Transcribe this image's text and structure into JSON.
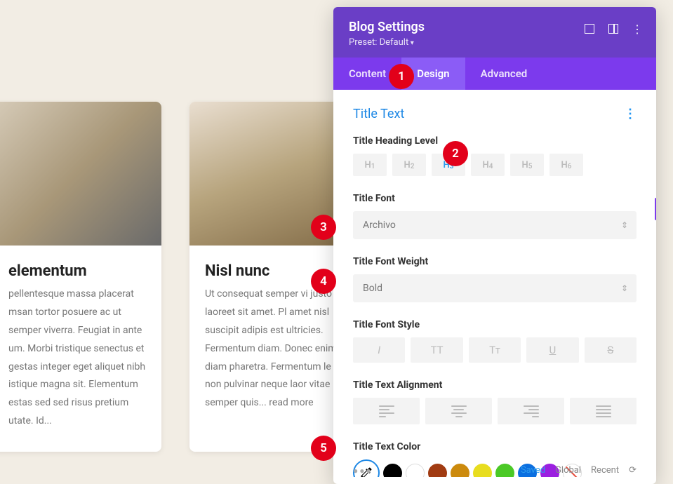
{
  "cards": [
    {
      "title": "elementum",
      "text": "pellentesque massa placerat msan tortor posuere ac ut  semper viverra. Feugiat in ante um. Morbi tristique senectus et gestas integer eget aliquet nibh istique magna sit. Elementum estas sed sed risus pretium utate. Id..."
    },
    {
      "title": "Nisl nunc",
      "text": "Ut consequat semper vi justo laoreet sit amet. Pl amet nisl suscipit adipis est ultricies. Fermentum diam. Donec enim diam pharetra. Fermentum le non pulvinar neque laor vitae semper quis... ",
      "readmore": "read more"
    }
  ],
  "panel": {
    "title": "Blog Settings",
    "preset": "Preset: Default"
  },
  "tabs": {
    "content": "Content",
    "design": "Design",
    "advanced": "Advanced"
  },
  "section": {
    "title": "Title Text"
  },
  "labels": {
    "heading": "Title Heading Level",
    "font": "Title Font",
    "weight": "Title Font Weight",
    "style": "Title Font Style",
    "align": "Title Text Alignment",
    "color": "Title Text Color"
  },
  "headingLevels": [
    "H1",
    "H2",
    "H3",
    "H4",
    "H5",
    "H6"
  ],
  "headingSelected": "H3",
  "font": "Archivo",
  "weight": "Bold",
  "styleButtons": {
    "italic": "I",
    "tt": "TT",
    "tc": "Tᴛ",
    "underline": "U",
    "strike": "S"
  },
  "swatches": [
    "#000000",
    "#ffffff",
    "#a13b12",
    "#cc8a0d",
    "#e8dd1f",
    "#4bc926",
    "#0b6fe0",
    "#9b1fe0"
  ],
  "footer": {
    "saved": "Saved",
    "global": "Global",
    "recent": "Recent"
  },
  "badges": [
    "1",
    "2",
    "3",
    "4",
    "5"
  ]
}
